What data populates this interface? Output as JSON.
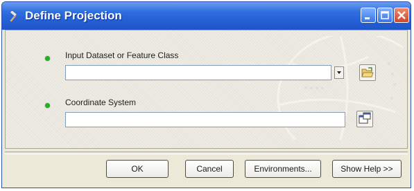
{
  "window": {
    "title": "Define Projection"
  },
  "fields": [
    {
      "label": "Input Dataset or Feature Class",
      "value": "",
      "required": true
    },
    {
      "label": "Coordinate System",
      "value": "",
      "required": true
    }
  ],
  "buttons": {
    "ok": "OK",
    "cancel": "Cancel",
    "environments": "Environments...",
    "show_help": "Show Help >>"
  },
  "colors": {
    "titlebar": "#245ed4",
    "required_dot": "#25b02a",
    "close_button": "#d0452a"
  },
  "icons": {
    "title": "hammer-icon",
    "browse": "open-folder-icon",
    "properties": "properties-icon"
  }
}
